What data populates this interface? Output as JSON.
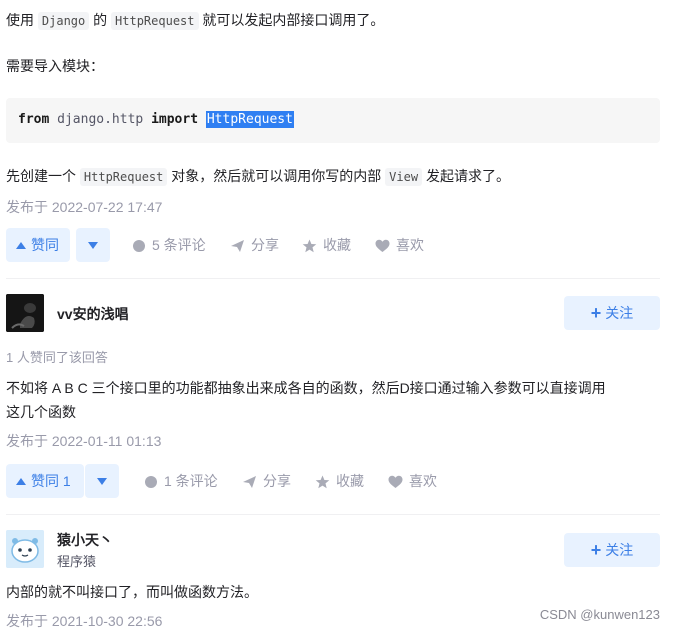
{
  "answer1": {
    "line1": {
      "t1": "使用 ",
      "code1": "Django",
      "t2": " 的 ",
      "code2": "HttpRequest",
      "t3": " 就可以发起内部接口调用了。"
    },
    "line2": "需要导入模块：",
    "code_block": {
      "kw_from": "from",
      "module": " django.http ",
      "kw_import": "import",
      "space": " ",
      "selected": "HttpRequest"
    },
    "line3": {
      "t1": "先创建一个 ",
      "code1": "HttpRequest",
      "t2": " 对象，然后就可以调用你写的内部 ",
      "code2": "View",
      "t3": " 发起请求了。"
    },
    "published": "发布于 2022-07-22 17:47",
    "actions": {
      "vote": "赞同",
      "comments": "5 条评论",
      "share": "分享",
      "favorite": "收藏",
      "like": "喜欢"
    }
  },
  "answer2": {
    "author": "vv安的浅唱",
    "follow": "关注",
    "upvote_note": "1 人赞同了该回答",
    "body_line1": "不如将 A B C 三个接口里的功能都抽象出来成各自的函数，然后D接口通过输入参数可以直接调用",
    "body_line2": "这几个函数",
    "published": "发布于 2022-01-11 01:13",
    "actions": {
      "vote": "赞同 1",
      "comments": "1 条评论",
      "share": "分享",
      "favorite": "收藏",
      "like": "喜欢"
    }
  },
  "answer3": {
    "author": "猿小天丶",
    "author_sub": "程序猿",
    "follow": "关注",
    "body": "内部的就不叫接口了，而叫做函数方法。",
    "published": "发布于 2021-10-30 22:56"
  },
  "watermark": "CSDN @kunwen123",
  "colors": {
    "accent": "#3c7fe6",
    "button_bg": "#e8f2ff",
    "meta_gray": "#999aaa",
    "selection": "#2f7ff2"
  }
}
